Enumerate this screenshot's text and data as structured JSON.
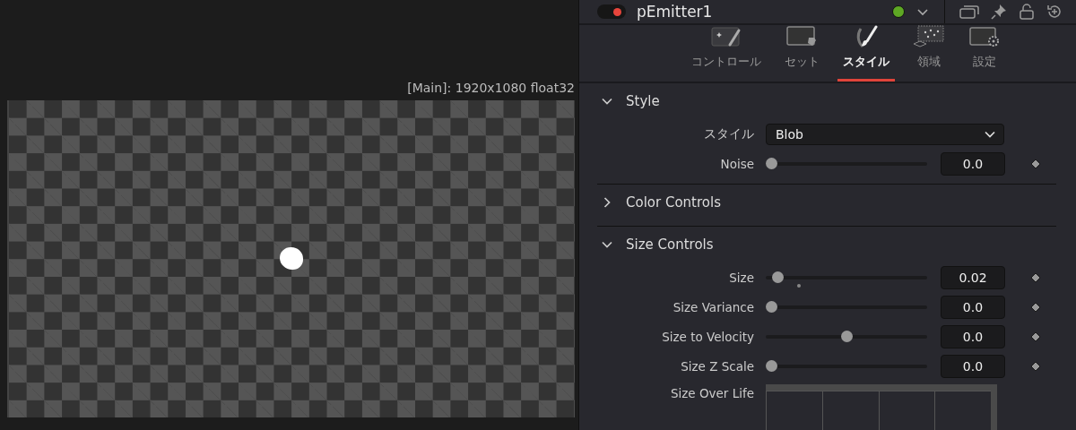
{
  "viewer": {
    "info": "[Main]: 1920x1080 float32"
  },
  "node": {
    "title": "pEmitter1",
    "enabled": true
  },
  "tabs": [
    {
      "label": "コントロール",
      "selected": false,
      "kind": "controls"
    },
    {
      "label": "セット",
      "selected": false,
      "kind": "set"
    },
    {
      "label": "スタイル",
      "selected": true,
      "kind": "style"
    },
    {
      "label": "領域",
      "selected": false,
      "kind": "region"
    },
    {
      "label": "設定",
      "selected": false,
      "kind": "settings"
    }
  ],
  "sections": [
    {
      "title": "Style",
      "expanded": true,
      "rows": [
        {
          "kind": "dropdown",
          "label": "スタイル",
          "value": "Blob"
        },
        {
          "kind": "slider",
          "label": "Noise",
          "level": 0,
          "value": "0.0",
          "default_marker": false
        }
      ]
    },
    {
      "title": "Color Controls",
      "expanded": false
    },
    {
      "title": "Size Controls",
      "expanded": true,
      "rows": [
        {
          "kind": "slider",
          "label": "Size",
          "level": 0.04,
          "value": "0.02",
          "default_marker": true
        },
        {
          "kind": "slider",
          "label": "Size Variance",
          "level": 0,
          "value": "0.0",
          "default_marker": false
        },
        {
          "kind": "slider",
          "label": "Size to Velocity",
          "level": 0.5,
          "value": "0.0",
          "default_marker": false
        },
        {
          "kind": "slider",
          "label": "Size Z Scale",
          "level": 0,
          "value": "0.0",
          "default_marker": false
        },
        {
          "kind": "curve",
          "label": "Size Over Life"
        }
      ]
    }
  ]
}
